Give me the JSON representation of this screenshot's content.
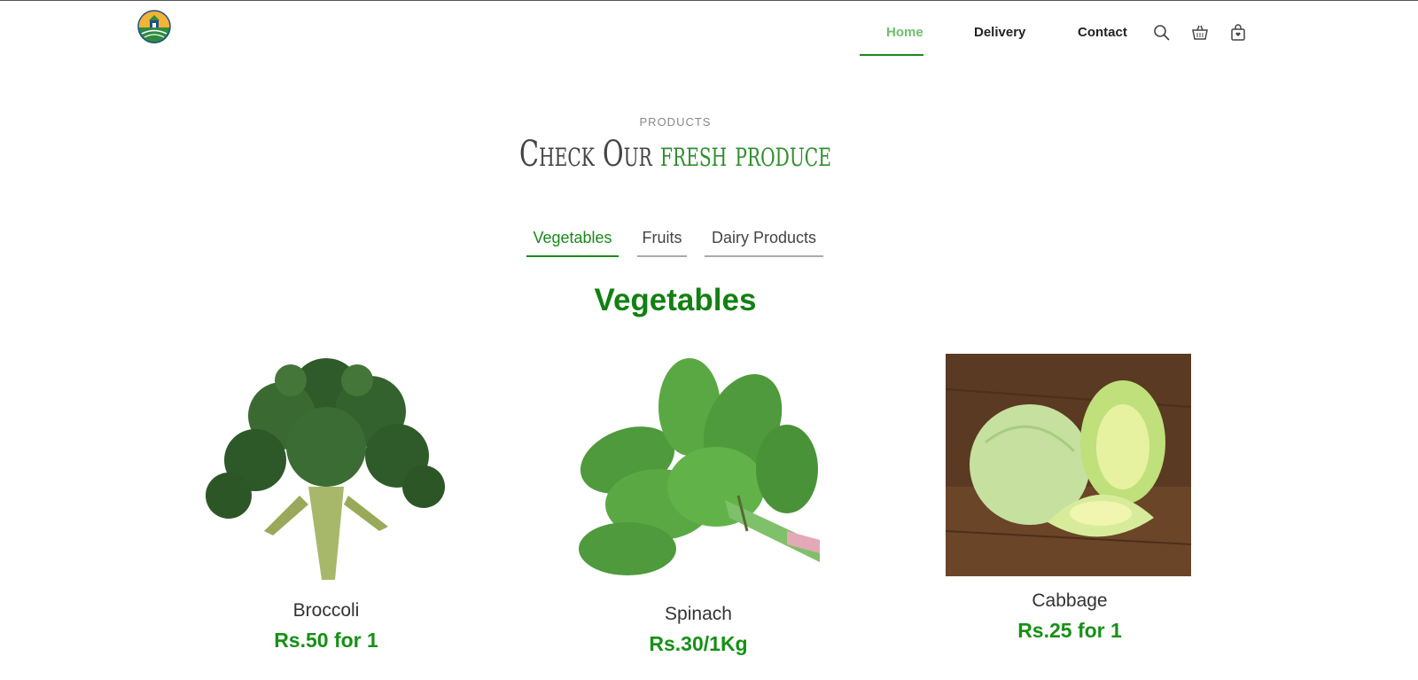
{
  "header": {
    "nav": [
      {
        "label": "Home",
        "active": true
      },
      {
        "label": "Delivery",
        "active": false
      },
      {
        "label": "Contact",
        "active": false
      }
    ],
    "icons": [
      "search-icon",
      "basket-icon",
      "shopping-bag-icon"
    ]
  },
  "section": {
    "eyebrow": "PRODUCTS",
    "headline_part1": "Check Our",
    "headline_part2": "fresh produce"
  },
  "tabs": [
    {
      "label": "Vegetables",
      "active": true
    },
    {
      "label": "Fruits",
      "active": false
    },
    {
      "label": "Dairy Products",
      "active": false
    }
  ],
  "category_title": "Vegetables",
  "products": [
    {
      "name": "Broccoli",
      "price": "Rs.50 for 1"
    },
    {
      "name": "Spinach",
      "price": "Rs.30/1Kg"
    },
    {
      "name": "Cabbage",
      "price": "Rs.25 for 1"
    }
  ],
  "colors": {
    "accent_green": "#1a8a1a",
    "active_nav": "#6cbf6c",
    "price_green": "#169016"
  }
}
